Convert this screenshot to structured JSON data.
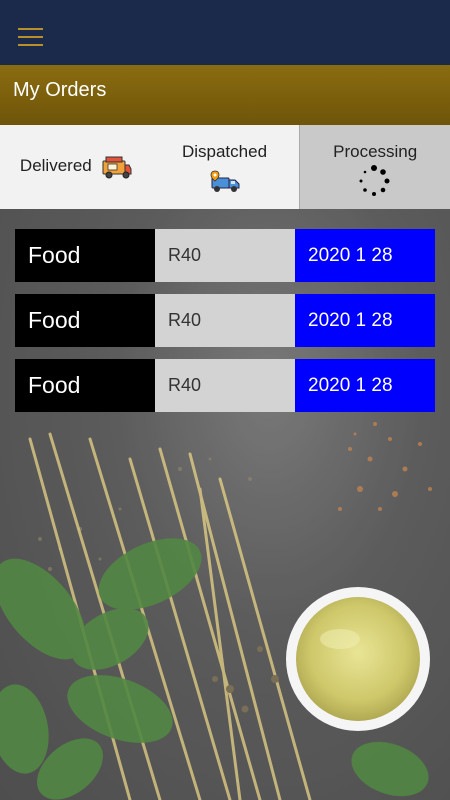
{
  "header": {
    "menu_icon": "hamburger-menu-icon",
    "accent": "#b8902a",
    "bar_color": "#1b2a4a"
  },
  "title_bar": {
    "title": "My Orders",
    "color": "#7a5e0c"
  },
  "tabs": [
    {
      "label": "Delivered",
      "icon": "food-truck-icon"
    },
    {
      "label": "Dispatched",
      "icon": "delivery-van-icon"
    },
    {
      "label": "Processing",
      "icon": "loading-spinner-icon",
      "active": true
    }
  ],
  "orders": [
    {
      "name": "Food",
      "price": "R40",
      "date": "2020 1 28"
    },
    {
      "name": "Food",
      "price": "R40",
      "date": "2020 1 28"
    },
    {
      "name": "Food",
      "price": "R40",
      "date": "2020 1 28"
    }
  ],
  "colors": {
    "name_cell": "#000000",
    "price_cell": "#d3d3d3",
    "date_cell": "#0000ff"
  }
}
